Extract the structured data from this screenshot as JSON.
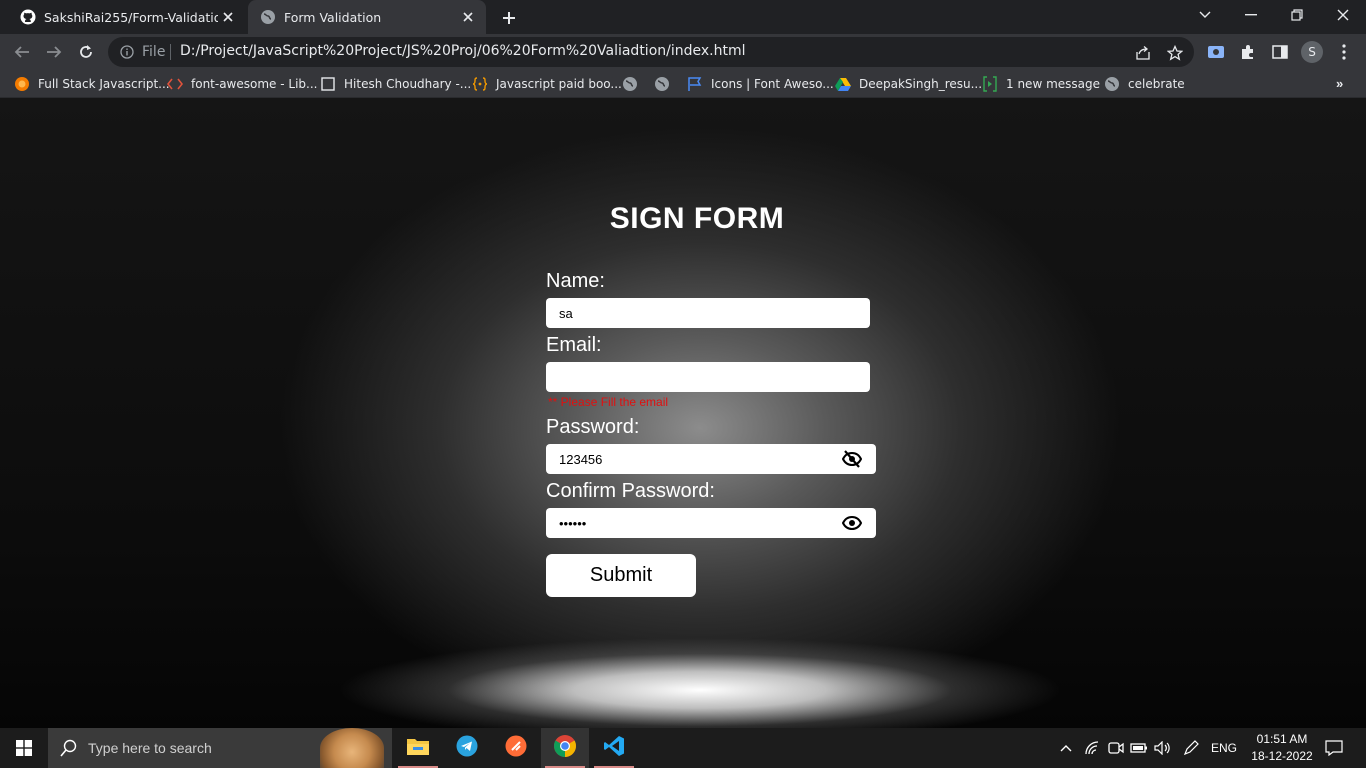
{
  "browser": {
    "tabs": [
      {
        "title": "SakshiRai255/Form-Validation",
        "icon": "github-icon",
        "active": false
      },
      {
        "title": "Form Validation",
        "icon": "globe-icon",
        "active": true
      }
    ],
    "address": {
      "scheme_label": "File",
      "url": "D:/Project/JavaScript%20Project/JS%20Proj/06%20Form%20Valiadtion/index.html"
    },
    "profile_initial": "S",
    "bookmarks": [
      {
        "label": "Full Stack Javascript...",
        "icon": "orange-circle-icon"
      },
      {
        "label": "font-awesome - Lib...",
        "icon": "code-brackets-icon"
      },
      {
        "label": "Hitesh Choudhary -...",
        "icon": "square-icon"
      },
      {
        "label": "Javascript paid boo...",
        "icon": "curly-braces-icon"
      },
      {
        "label": "",
        "icon": "globe-icon"
      },
      {
        "label": "",
        "icon": "globe-icon"
      },
      {
        "label": "Icons | Font Aweso...",
        "icon": "flag-icon"
      },
      {
        "label": "DeepakSingh_resu...",
        "icon": "google-drive-icon"
      },
      {
        "label": "1 new message",
        "icon": "chat-icon"
      },
      {
        "label": "celebrate",
        "icon": "globe-icon"
      }
    ],
    "bookmarks_more": "»"
  },
  "form": {
    "title": "SIGN FORM",
    "name_label": "Name:",
    "name_value": "sa",
    "email_label": "Email:",
    "email_value": "",
    "email_error": "** Please Fill the email",
    "password_label": "Password:",
    "password_value": "123456",
    "confirm_label": "Confirm Password:",
    "confirm_value": "••••••",
    "submit_label": "Submit"
  },
  "taskbar": {
    "search_placeholder": "Type here to search",
    "apps": [
      "file-explorer-icon",
      "telegram-icon",
      "postman-icon",
      "chrome-icon",
      "vscode-icon"
    ],
    "language": "ENG",
    "time": "01:51 AM",
    "date": "18-12-2022"
  },
  "colors": {
    "error": "#e01010",
    "tab_active": "#35363a",
    "chrome_dark": "#202124"
  }
}
